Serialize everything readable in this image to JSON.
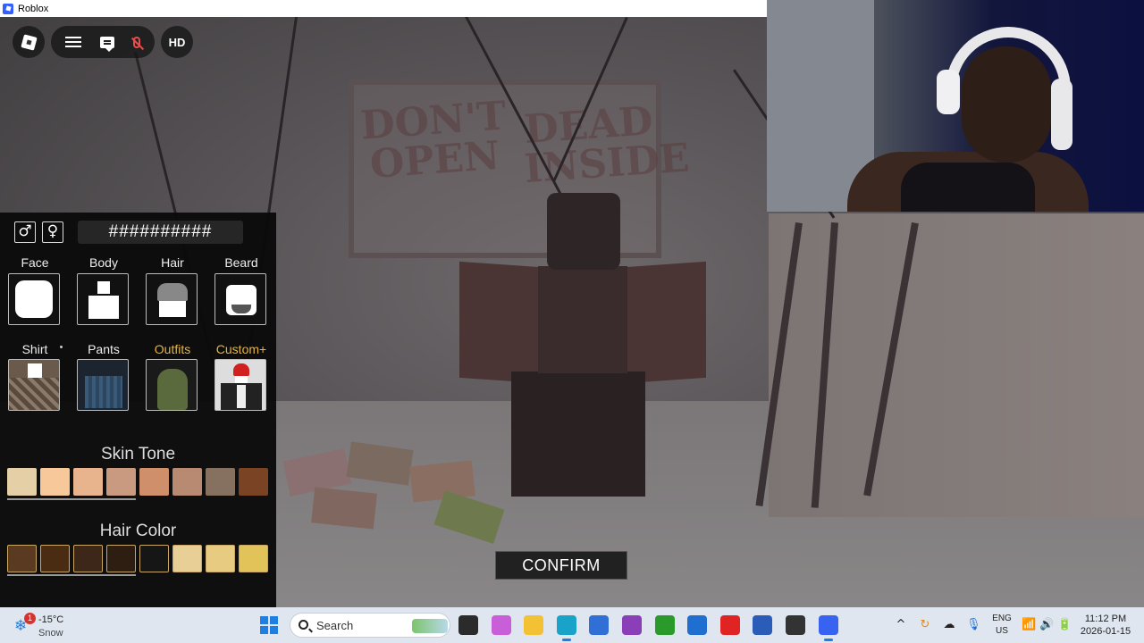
{
  "window": {
    "title": "Roblox",
    "icon": "roblox-icon"
  },
  "topbar": {
    "logo_icon": "roblox-logo-icon",
    "menu_icon": "hamburger-menu-icon",
    "chat_icon": "chat-icon",
    "mic_icon": "microphone-muted-icon",
    "hd_label": "HD"
  },
  "scene": {
    "sign_left": "DON'T OPEN",
    "sign_right": "DEAD INSIDE"
  },
  "customizer": {
    "gender_male": "♂",
    "gender_female": "♀",
    "name_value": "##########",
    "categories_row1": [
      {
        "label": "Face",
        "icon": "face-tile"
      },
      {
        "label": "Body",
        "icon": "body-tile"
      },
      {
        "label": "Hair",
        "icon": "hair-tile"
      },
      {
        "label": "Beard",
        "icon": "beard-tile"
      }
    ],
    "categories_row2": [
      {
        "label": "Shirt",
        "icon": "shirt-tile"
      },
      {
        "label": "Pants",
        "icon": "pants-tile"
      },
      {
        "label": "Outfits",
        "icon": "outfits-tile",
        "accent": "#e8b53a"
      },
      {
        "label": "Custom+",
        "icon": "custom-tile",
        "accent": "#e8b53a"
      }
    ],
    "skin_tone_title": "Skin Tone",
    "skin_tones": [
      "#e4cfa6",
      "#f7c99a",
      "#e8b48e",
      "#c99a80",
      "#cf8f6a",
      "#b88a72",
      "#86705f",
      "#7a4424"
    ],
    "hair_color_title": "Hair Color",
    "hair_colors": [
      "#5a3a20",
      "#4a2c12",
      "#3d2718",
      "#2e1e12",
      "#161616",
      "#e8cf96",
      "#e6cb80",
      "#e2c35a"
    ]
  },
  "confirm_label": "CONFIRM",
  "taskbar": {
    "weather_badge": "1",
    "weather_temp": "-15°C",
    "weather_condition": "Snow",
    "weather_icon": "snowflake-icon",
    "search_label": "Search",
    "apps": [
      {
        "name": "task-view-icon",
        "color": "#2b2b2b"
      },
      {
        "name": "copilot-icon",
        "color": "#c85fd8"
      },
      {
        "name": "file-explorer-icon",
        "color": "#f2c234"
      },
      {
        "name": "edge-icon",
        "color": "#1aa3c9"
      },
      {
        "name": "store-icon",
        "color": "#2f6fd6"
      },
      {
        "name": "app-purple-icon",
        "color": "#8a3fb8"
      },
      {
        "name": "xbox-icon",
        "color": "#2a9b2a"
      },
      {
        "name": "outlook-icon",
        "color": "#1e6fd0"
      },
      {
        "name": "youtube-icon",
        "color": "#e02424"
      },
      {
        "name": "word-icon",
        "color": "#2b5cb8"
      },
      {
        "name": "obs-icon",
        "color": "#333333"
      },
      {
        "name": "roblox-taskbar-icon",
        "color": "#3863f0"
      }
    ],
    "language_line1": "ENG",
    "language_line2": "US",
    "time": "11:12 PM",
    "date": "2026-01-15"
  }
}
